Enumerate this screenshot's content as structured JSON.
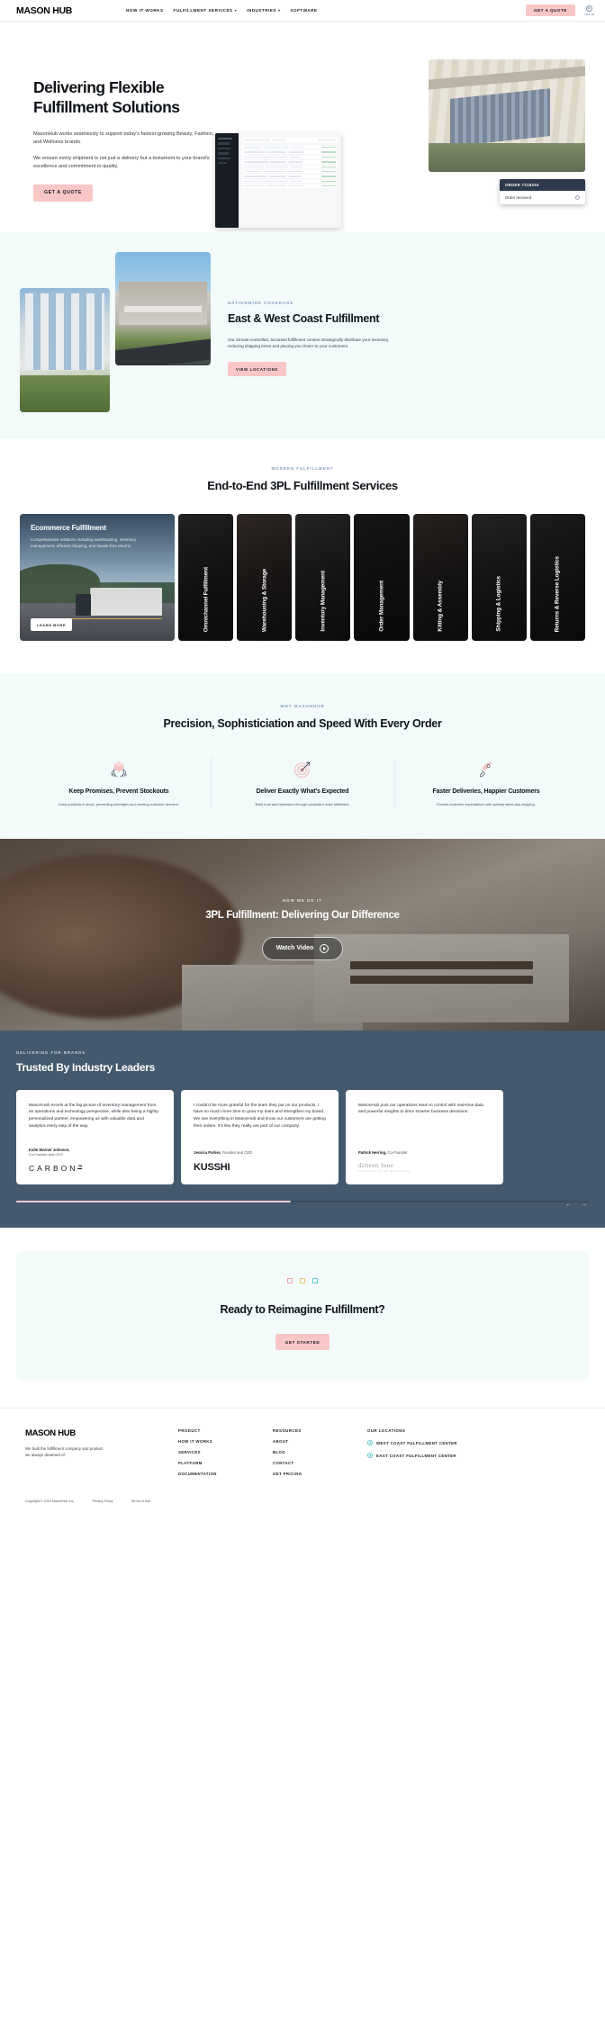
{
  "header": {
    "logo": "MASON HUB",
    "nav": [
      {
        "label": "HOW IT WORKS",
        "caret": false
      },
      {
        "label": "FULFILLMENT SERVICES",
        "caret": true
      },
      {
        "label": "INDUSTRIES",
        "caret": true
      },
      {
        "label": "SOFTWARE",
        "caret": false
      }
    ],
    "cta": "GET A QUOTE",
    "login": "LOG IN"
  },
  "hero": {
    "title": "Delivering Flexible Fulfillment Solutions",
    "paragraph1": "MasonHub works seamlessly to support today's fastest-growing Beauty, Fashion, and Wellness brands.",
    "paragraph2": "We ensure every shipment is not just a delivery but a testament to your brand's excellence and commitment to quality.",
    "cta": "GET A QUOTE",
    "toast_title": "ORDER 7218253",
    "toast_body": "Order received"
  },
  "coverage": {
    "eyebrow": "NATIONWIDE COVERAGE",
    "title": "East & West Coast Fulfillment",
    "paragraph": "Our climate-controlled, bicoastal fulfillment centers strategically distribute your inventory, reducing shipping times and placing you closer to your customers.",
    "cta": "VIEW LOCATIONS"
  },
  "services": {
    "eyebrow": "MODERN FULFILLMENT",
    "title": "End-to-End 3PL Fulfillment Services",
    "featured": {
      "title": "Ecommerce Fulfillment",
      "description": "Comprehensive solutions including warehousing, inventory management, efficient shipping, and hassle-free returns",
      "cta": "LEARN MORE"
    },
    "cards": [
      "Omnichannel Fulfillment",
      "Warehousing & Storage",
      "Inventory Management",
      "Order Management",
      "Kitting & Assembly",
      "Shipping & Logistics",
      "Returns & Reverse Logistics"
    ]
  },
  "why": {
    "eyebrow": "WHY MASONHUB",
    "title": "Precision, Sophisticiation and Speed With Every Order",
    "features": [
      {
        "icon": "hands-box-icon",
        "title": "Keep Promises, Prevent Stockouts",
        "text": "Keep products in stock, preventing shortages and meeting customer demand."
      },
      {
        "icon": "target-arrow-icon",
        "title": "Deliver Exactly What's Expected",
        "text": "Build trust and reputation through consistent order fulfillment."
      },
      {
        "icon": "rocket-icon",
        "title": "Faster Deliveries, Happier Customers",
        "text": "Exceed customer expectations with speedy same-day shipping."
      }
    ]
  },
  "video": {
    "eyebrow": "HOW WE DO IT",
    "title": "3PL Fulfillment: Delivering Our Difference",
    "button": "Watch Video"
  },
  "testimonials": {
    "eyebrow": "DELIVERING FOR BRANDS",
    "title": "Trusted By Industry Leaders",
    "items": [
      {
        "quote": "MasonHub excels at the big picture of inventory management from an operations and technology perspective, while also being a highly-personalized partner, empowering us with valuable data and analytics every step of the way.",
        "name": "Katie Warner Johnson,",
        "role": "Co-Founder and CEO",
        "logo": "CARBON",
        "logo_sup": "38"
      },
      {
        "quote": "I couldn't be more grateful for the team they put on our products. I have so much more time to grow my team and strengthen my brand. We see everything in MasonHub and know our customers are getting their orders. It's like they really are part of our company.",
        "name": "Jessica Parker,",
        "role": "Founder and CEO",
        "logo": "KUSSHI"
      },
      {
        "quote": "MasonHub puts our operations team in control with real-time data and powerful insights to drive smarter business decisions.",
        "name": "Patrick Herring,",
        "role": "Co-Founder",
        "logo": "dirteen lune",
        "logo_sub": "THE BEAUTY OF WELLNESS"
      }
    ],
    "prev_icon": "arrow-left-icon",
    "next_icon": "arrow-right-icon"
  },
  "cta": {
    "title": "Ready to Reimagine Fulfillment?",
    "button": "GET STARTED"
  },
  "footer": {
    "logo": "MASON HUB",
    "tagline": "We built the fulfillment company and product we always dreamed of.",
    "columns": [
      {
        "heading": "PRODUCT",
        "links": [
          "HOW IT WORKS",
          "SERVICES",
          "PLATFORM",
          "DOCUMENTATION"
        ]
      },
      {
        "heading": "RESOURCES",
        "links": [
          "ABOUT",
          "BLOG",
          "CONTACT",
          "GET PRICING"
        ]
      }
    ],
    "locations_heading": "OUR LOCATIONS",
    "locations": [
      "WEST COAST FULFILLMENT CENTER",
      "EAST COAST FULFILLMENT CENTER"
    ],
    "copyright": "Copyright © 2023 MasonHub Inc.",
    "privacy": "Privacy Policy",
    "terms": "Terms of Use"
  }
}
